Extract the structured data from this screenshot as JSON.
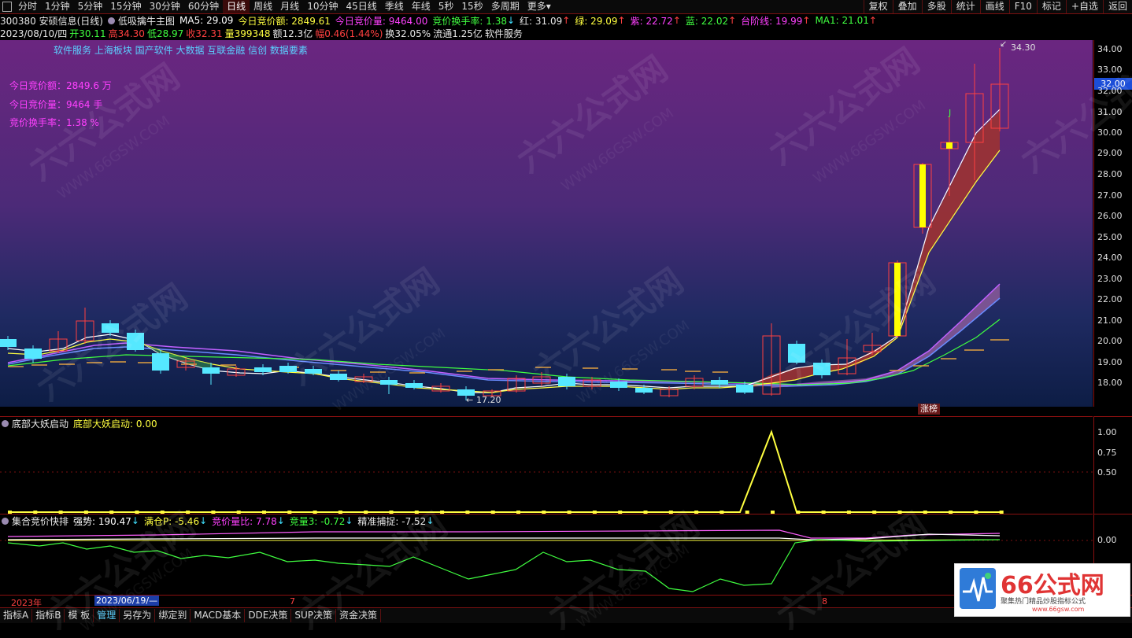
{
  "topbar": {
    "tabs": [
      "分时",
      "1分钟",
      "5分钟",
      "15分钟",
      "30分钟",
      "60分钟",
      "日线",
      "周线",
      "月线",
      "10分钟",
      "45日线",
      "季线",
      "年线",
      "5秒",
      "15秒",
      "多周期",
      "更多"
    ],
    "active_tab": "日线",
    "more_suffix": "▾",
    "right_buttons": [
      "复权",
      "叠加",
      "多股",
      "统计",
      "画线",
      "F10",
      "标记",
      "+自选",
      "返回"
    ]
  },
  "info1": {
    "stock": "300380 安硕信息(日线)",
    "indicator": "低吸擒牛主图",
    "ma5": "MA5: 29.09",
    "jj_amount": "今日竞价额: 2849.61",
    "jj_volume": "今日竞价量: 9464.00",
    "jj_turnover": "竞价换手率: 1.38",
    "arrow_down": "↓",
    "arrow_up": "↑",
    "red": "红: 31.09",
    "green": "绿: 29.09",
    "purple": "紫: 22.72",
    "blue": "蓝: 22.02",
    "step": "台阶线: 19.99",
    "ma1": "MA1: 21.01"
  },
  "info2": {
    "date": "2023/08/10/四",
    "open": "开30.11",
    "high": "高34.30",
    "low": "低28.97",
    "close": "收32.31",
    "vol": "量399348",
    "amount": "额12.3亿",
    "change": "幅0.46(1.44%)",
    "turnover": "换32.05%",
    "float": "流通1.25亿",
    "sector": "软件服务"
  },
  "concepts": "软件服务 上海板块 国产软件 大数据 互联金融 信创 数据要素",
  "annotations": [
    "今日竞价额：2849.6 万",
    "今日竞价量：9464 手",
    "竞价换手率：1.38 %"
  ],
  "price_axis": {
    "ticks": [
      "34.00",
      "33.00",
      "32.00",
      "31.00",
      "30.00",
      "29.00",
      "28.00",
      "27.00",
      "26.00",
      "25.00",
      "24.00",
      "23.00",
      "22.00",
      "21.00",
      "20.00",
      "19.00",
      "18.00"
    ],
    "current": "32.00"
  },
  "labels": {
    "high": "34.30",
    "low": "17.20",
    "zt": "涨榜",
    "j_mark": "J"
  },
  "sub1": {
    "title": "底部大妖启动",
    "value_label": "底部大妖启动: 0.00",
    "ticks": [
      "1.00",
      "0.75",
      "0.50"
    ]
  },
  "sub2": {
    "title": "集合竞价快排",
    "items": [
      "强势: 190.47",
      "满仓P: -5.46",
      "竞价量比: 7.78",
      "竞量3: -0.72",
      "精准捕捉: -7.52"
    ],
    "tick": "0.00"
  },
  "timeaxis": {
    "year": "2023年",
    "cursor": "2023/06/19/—",
    "m7": "7",
    "m8": "8"
  },
  "bottombar": {
    "tabs": [
      "指标A",
      "指标B",
      "模 板",
      "管理",
      "另存为",
      "绑定到",
      "MACD基本",
      "DDE决策",
      "SUP决策",
      "资金决策"
    ],
    "active": "管理"
  },
  "logo": {
    "title": "66公式网",
    "sub": "聚集热门精品炒股指标公式",
    "url": "www.66gsw.com"
  },
  "watermark": {
    "cn": "六六公式网",
    "url": "WWW.66GSW.COM"
  },
  "colors": {
    "up": "#ff4040",
    "down": "#55e8ff",
    "yellow": "#ffff00",
    "magenta": "#ff40ff",
    "green": "#40ff40"
  }
}
